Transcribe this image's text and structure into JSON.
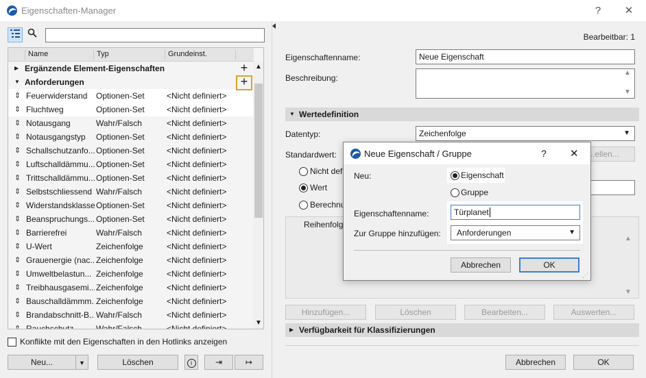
{
  "window": {
    "title": "Eigenschaften-Manager",
    "help": "?",
    "close": "✕"
  },
  "left": {
    "columns": [
      "Name",
      "Typ",
      "Grundeinst."
    ],
    "groups": [
      {
        "label": "Ergänzende Element-Eigenschaften"
      },
      {
        "label": "Anforderungen"
      }
    ],
    "rows": [
      {
        "name": "Feuerwiderstand",
        "typ": "Optionen-Set",
        "grund": "<Nicht definiert>"
      },
      {
        "name": "Fluchtweg",
        "typ": "Optionen-Set",
        "grund": "<Nicht definiert>"
      },
      {
        "name": "Notausgang",
        "typ": "Wahr/Falsch",
        "grund": "<Nicht definiert>"
      },
      {
        "name": "Notausgangstyp",
        "typ": "Optionen-Set",
        "grund": "<Nicht definiert>"
      },
      {
        "name": "Schallschutzanfo...",
        "typ": "Optionen-Set",
        "grund": "<Nicht definiert>"
      },
      {
        "name": "Luftschalldämmu...",
        "typ": "Optionen-Set",
        "grund": "<Nicht definiert>"
      },
      {
        "name": "Trittschalldämmu...",
        "typ": "Optionen-Set",
        "grund": "<Nicht definiert>"
      },
      {
        "name": "Selbstschliessend",
        "typ": "Wahr/Falsch",
        "grund": "<Nicht definiert>"
      },
      {
        "name": "Widerstandsklasse",
        "typ": "Optionen-Set",
        "grund": "<Nicht definiert>"
      },
      {
        "name": "Beanspruchungs...",
        "typ": "Optionen-Set",
        "grund": "<Nicht definiert>"
      },
      {
        "name": "Barrierefrei",
        "typ": "Wahr/Falsch",
        "grund": "<Nicht definiert>"
      },
      {
        "name": "U-Wert",
        "typ": "Zeichenfolge",
        "grund": "<Nicht definiert>"
      },
      {
        "name": "Grauenergie (nac...",
        "typ": "Zeichenfolge",
        "grund": "<Nicht definiert>"
      },
      {
        "name": "Umweltbelastun...",
        "typ": "Zeichenfolge",
        "grund": "<Nicht definiert>"
      },
      {
        "name": "Treibhausgasemi...",
        "typ": "Zeichenfolge",
        "grund": "<Nicht definiert>"
      },
      {
        "name": "Bauschalldämmm...",
        "typ": "Zeichenfolge",
        "grund": "<Nicht definiert>"
      },
      {
        "name": "Brandabschnitt-B...",
        "typ": "Wahr/Falsch",
        "grund": "<Nicht definiert>"
      },
      {
        "name": "Rauchschutz",
        "typ": "Wahr/Falsch",
        "grund": "<Nicht definiert>"
      }
    ],
    "hotlinks_checkbox": "Konflikte mit den Eigenschaften in den Hotlinks anzeigen",
    "new_button": "Neu...",
    "delete_button": "Löschen"
  },
  "right": {
    "editable": "Bearbeitbar: 1",
    "name_label": "Eigenschaftenname:",
    "name_value": "Neue Eigenschaft",
    "desc_label": "Beschreibung:",
    "section_values": "Wertedefinition",
    "datatype_label": "Datentyp:",
    "datatype_value": "Zeichenfolge",
    "default_label": "Standardwert:",
    "default_btn": "...ellen...",
    "radio_1": "Nicht defi",
    "radio_2": "Wert",
    "radio_3": "Berechnu",
    "order_col": "Reihenfolg",
    "btn_add": "Hinzufügen...",
    "btn_delete": "Löschen",
    "btn_edit": "Bearbeiten...",
    "btn_eval": "Auswerten...",
    "section_availability": "Verfügbarkeit für Klassifizierungen",
    "cancel": "Abbrechen",
    "ok": "OK"
  },
  "dialog": {
    "title": "Neue Eigenschaft / Gruppe",
    "help": "?",
    "close": "✕",
    "new_label": "Neu:",
    "option_property": "Eigenschaft",
    "option_group": "Gruppe",
    "name_label": "Eigenschaftenname:",
    "name_value": "Türplanet",
    "group_label": "Zur Gruppe hinzufügen:",
    "group_value": "Anforderungen",
    "cancel": "Abbrechen",
    "ok": "OK"
  }
}
